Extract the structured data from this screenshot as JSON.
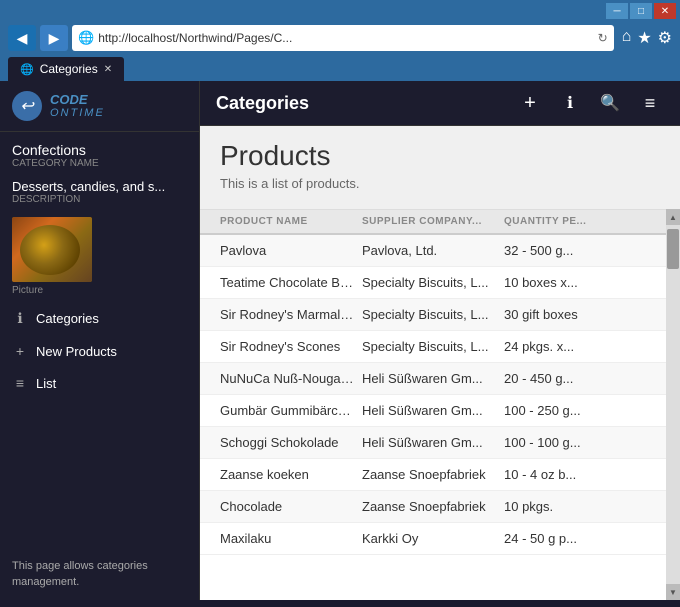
{
  "browser": {
    "url": "http://localhost/Northwind/Pages/C...",
    "title": "Categories",
    "tab_label": "Categories",
    "back_btn": "◀",
    "forward_btn": "▶",
    "refresh_btn": "↻",
    "titlebar_buttons": {
      "minimize": "─",
      "maximize": "□",
      "close": "✕"
    },
    "right_icons": [
      "⌂",
      "★",
      "⚙"
    ]
  },
  "sidebar": {
    "brand": {
      "name1": "CODE",
      "name2": "ONTIME"
    },
    "category_name_label": "Category Name",
    "category_name_value": "Confections",
    "description_label": "Description",
    "description_value": "Desserts, candies, and s...",
    "picture_label": "Picture",
    "nav_items": [
      {
        "id": "categories",
        "icon": "ℹ",
        "label": "Categories"
      },
      {
        "id": "new-products",
        "icon": "+",
        "label": "New Products"
      },
      {
        "id": "list",
        "icon": "≡",
        "label": "List"
      }
    ],
    "page_description": "This page allows categories management."
  },
  "page_header": {
    "title": "Categories",
    "icons": {
      "plus": "+",
      "info": "ℹ",
      "search": "🔍",
      "menu": "≡"
    }
  },
  "content": {
    "title": "Products",
    "subtitle": "This is a list of products.",
    "table": {
      "columns": [
        {
          "key": "product_name",
          "label": "PRODUCT NAME"
        },
        {
          "key": "supplier",
          "label": "SUPPLIER COMPANY..."
        },
        {
          "key": "quantity",
          "label": "QUANTITY PE..."
        }
      ],
      "rows": [
        {
          "product_name": "Pavlova",
          "supplier": "Pavlova, Ltd.",
          "quantity": "32 - 500 g..."
        },
        {
          "product_name": "Teatime Chocolate Biscuits",
          "supplier": "Specialty Biscuits, L...",
          "quantity": "10 boxes x..."
        },
        {
          "product_name": "Sir Rodney's Marmalade",
          "supplier": "Specialty Biscuits, L...",
          "quantity": "30 gift boxes"
        },
        {
          "product_name": "Sir Rodney's Scones",
          "supplier": "Specialty Biscuits, L...",
          "quantity": "24 pkgs. x..."
        },
        {
          "product_name": "NuNuCa Nuß-Nougat-Cre...",
          "supplier": "Heli Süßwaren Gm...",
          "quantity": "20 - 450 g..."
        },
        {
          "product_name": "Gumbär Gummibärchen",
          "supplier": "Heli Süßwaren Gm...",
          "quantity": "100 - 250 g..."
        },
        {
          "product_name": "Schoggi Schokolade",
          "supplier": "Heli Süßwaren Gm...",
          "quantity": "100 - 100 g..."
        },
        {
          "product_name": "Zaanse koeken",
          "supplier": "Zaanse Snoepfabriek",
          "quantity": "10 - 4 oz b..."
        },
        {
          "product_name": "Chocolade",
          "supplier": "Zaanse Snoepfabriek",
          "quantity": "10 pkgs."
        },
        {
          "product_name": "Maxilaku",
          "supplier": "Karkki Oy",
          "quantity": "24 - 50 g p..."
        }
      ]
    }
  }
}
